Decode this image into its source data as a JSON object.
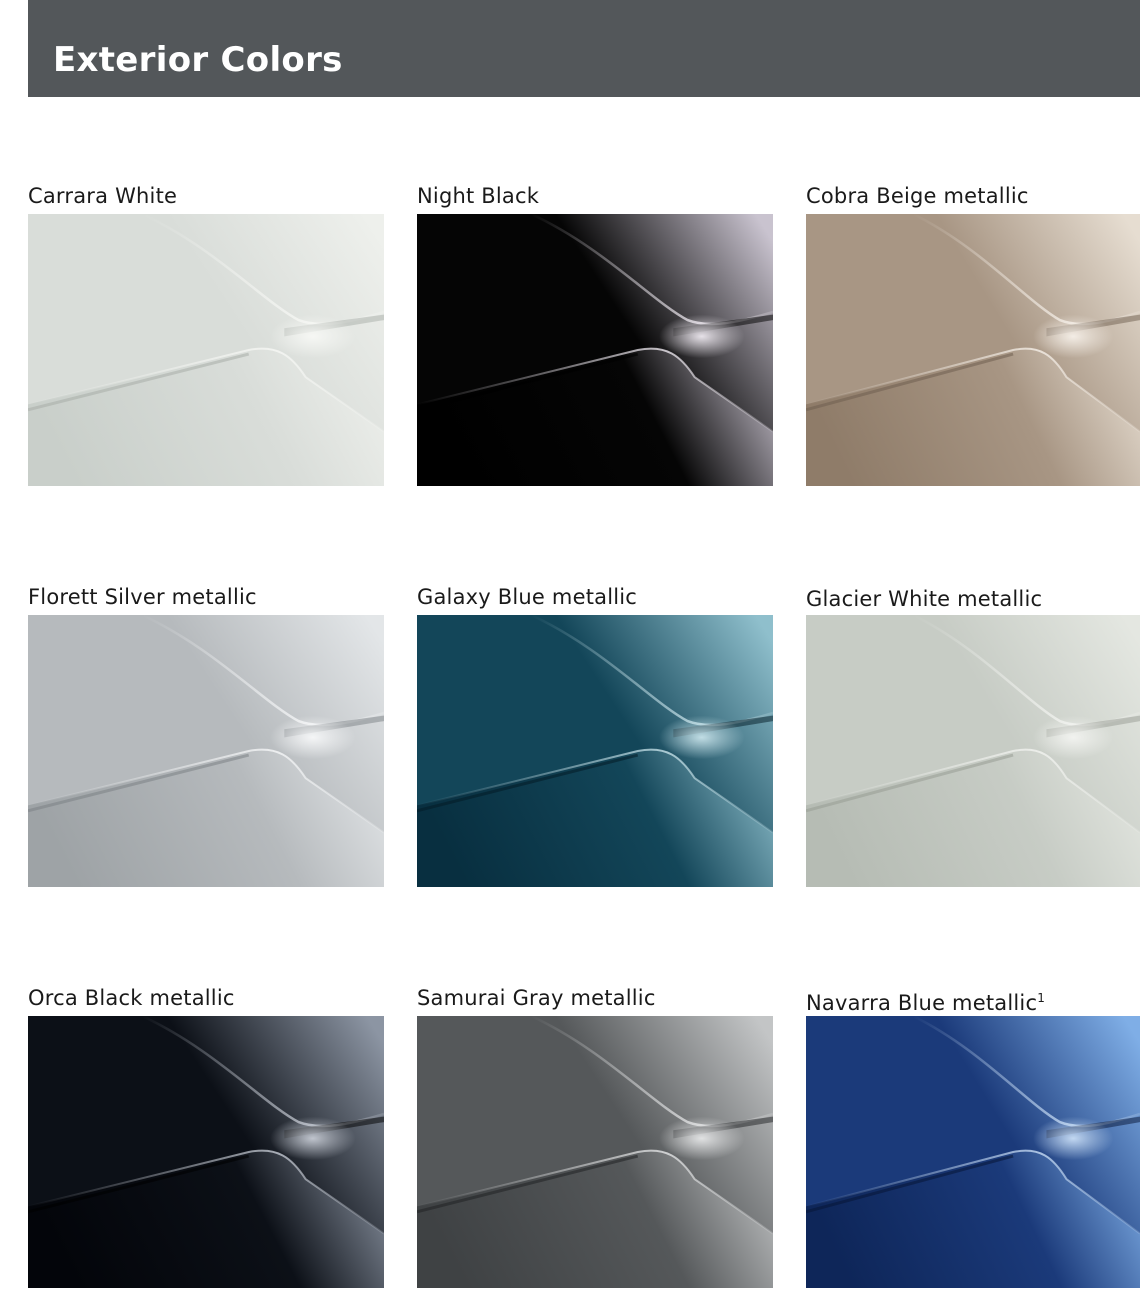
{
  "header": {
    "title": "Exterior Colors"
  },
  "colors": [
    {
      "name": "Carrara White",
      "base": "#d9ddd9",
      "dark": "#c9cfca",
      "light": "#eef0ec",
      "line": "#a7ada8",
      "glow": "#f7f8f5"
    },
    {
      "name": "Night Black",
      "base": "#050505",
      "dark": "#000000",
      "light": "#c9c3cf",
      "line": "#000000",
      "glow": "#efeaf1"
    },
    {
      "name": "Cobra Beige metallic",
      "base": "#a89684",
      "dark": "#8f7c69",
      "light": "#e6ddd1",
      "line": "#6f5f50",
      "glow": "#f6f0e9"
    },
    {
      "name": "Florett Silver metallic",
      "base": "#b6babd",
      "dark": "#9ea3a6",
      "light": "#e3e6e8",
      "line": "#7b8185",
      "glow": "#f7f8f9"
    },
    {
      "name": "Galaxy Blue metallic",
      "base": "#134659",
      "dark": "#082f40",
      "light": "#8fbfcc",
      "line": "#041b26",
      "glow": "#c8e3ea"
    },
    {
      "name": "Glacier White metallic",
      "base": "#c7ccc5",
      "dark": "#b6bcb4",
      "light": "#e4e7e1",
      "line": "#979c94",
      "glow": "#f3f4f1"
    },
    {
      "name": "Orca Black metallic",
      "base": "#0c1017",
      "dark": "#03050a",
      "light": "#8c95a3",
      "line": "#000000",
      "glow": "#c7ccd5"
    },
    {
      "name": "Samurai Gray metallic",
      "base": "#55585a",
      "dark": "#3f4244",
      "light": "#c3c5c6",
      "line": "#202224",
      "glow": "#e6e7e8"
    },
    {
      "name": "Navarra Blue metallic",
      "sup": "1",
      "base": "#1b3a7a",
      "dark": "#0e2659",
      "light": "#7faee6",
      "line": "#071636",
      "glow": "#c9def6"
    }
  ]
}
